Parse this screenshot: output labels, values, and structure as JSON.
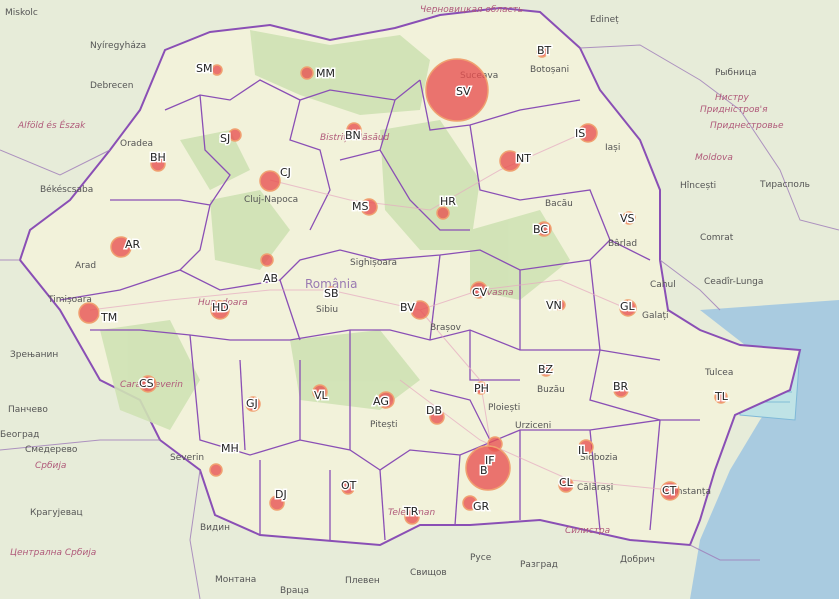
{
  "map": {
    "colors": {
      "bubble": "#e8504f",
      "bubble_stroke": "#f0a070",
      "border": "#8a4fb5",
      "land": "#e4ead3",
      "romania": "#f2f1d8",
      "forest": "#cfe2b4",
      "water": "#a9cbe0"
    },
    "country_label": "România",
    "counties": [
      {
        "code": "SM",
        "size": 5
      },
      {
        "code": "MM",
        "size": 6
      },
      {
        "code": "BT",
        "size": 5
      },
      {
        "code": "SV",
        "size": 31
      },
      {
        "code": "SJ",
        "size": 6
      },
      {
        "code": "BN",
        "size": 7
      },
      {
        "code": "IS",
        "size": 9
      },
      {
        "code": "BH",
        "size": 7
      },
      {
        "code": "CJ",
        "size": 10
      },
      {
        "code": "NT",
        "size": 10
      },
      {
        "code": "MS",
        "size": 8
      },
      {
        "code": "HR",
        "size": 6
      },
      {
        "code": "BC",
        "size": 7
      },
      {
        "code": "VS",
        "size": 6
      },
      {
        "code": "AR",
        "size": 10
      },
      {
        "code": "AB",
        "size": 6
      },
      {
        "code": "SB",
        "size": 5
      },
      {
        "code": "CV",
        "size": 8
      },
      {
        "code": "TM",
        "size": 10
      },
      {
        "code": "HD",
        "size": 9
      },
      {
        "code": "BV",
        "size": 9
      },
      {
        "code": "VN",
        "size": 5
      },
      {
        "code": "GL",
        "size": 8
      },
      {
        "code": "CS",
        "size": 8
      },
      {
        "code": "BZ",
        "size": 6
      },
      {
        "code": "BR",
        "size": 7
      },
      {
        "code": "PH",
        "size": 6
      },
      {
        "code": "GJ",
        "size": 7
      },
      {
        "code": "VL",
        "size": 7
      },
      {
        "code": "AG",
        "size": 8
      },
      {
        "code": "DB",
        "size": 7
      },
      {
        "code": "TL",
        "size": 6
      },
      {
        "code": "MH",
        "size": 6
      },
      {
        "code": "IL",
        "size": 7
      },
      {
        "code": "IF",
        "size": 7
      },
      {
        "code": "B",
        "size": 22
      },
      {
        "code": "CL",
        "size": 7
      },
      {
        "code": "DJ",
        "size": 7
      },
      {
        "code": "OT",
        "size": 6
      },
      {
        "code": "TR",
        "size": 7
      },
      {
        "code": "GR",
        "size": 7
      },
      {
        "code": "CT",
        "size": 9
      }
    ],
    "places": [
      {
        "name": "Miskolc"
      },
      {
        "name": "Nyíregyháza"
      },
      {
        "name": "Debrecen"
      },
      {
        "name": "Alföld és Észak",
        "style": "region"
      },
      {
        "name": "Oradea"
      },
      {
        "name": "Békéscsaba"
      },
      {
        "name": "Arad"
      },
      {
        "name": "Timișoara"
      },
      {
        "name": "Cluj-Napoca"
      },
      {
        "name": "Suceava"
      },
      {
        "name": "Botoșani"
      },
      {
        "name": "Iași"
      },
      {
        "name": "Bacău"
      },
      {
        "name": "Bârlad"
      },
      {
        "name": "Galați"
      },
      {
        "name": "Brașov"
      },
      {
        "name": "Sibiu"
      },
      {
        "name": "Sighișoara"
      },
      {
        "name": "Ploiești"
      },
      {
        "name": "Buzău"
      },
      {
        "name": "Pitești"
      },
      {
        "name": "Moldova",
        "style": "region"
      },
      {
        "name": "Hîncești"
      },
      {
        "name": "Comrat"
      },
      {
        "name": "Cahul"
      },
      {
        "name": "Ceadîr-Lunga"
      },
      {
        "name": "Тирасполь"
      },
      {
        "name": "Рыбница"
      },
      {
        "name": "Edineț"
      },
      {
        "name": "Черновицкая область",
        "style": "region"
      },
      {
        "name": "Придністров'я",
        "style": "region"
      },
      {
        "name": "Приднестровье",
        "style": "region"
      },
      {
        "name": "Нистру",
        "style": "region"
      },
      {
        "name": "Србија",
        "style": "region"
      },
      {
        "name": "Панчево"
      },
      {
        "name": "Београд"
      },
      {
        "name": "Смедерево"
      },
      {
        "name": "Зрењанин"
      },
      {
        "name": "Крагујевац"
      },
      {
        "name": "Централна Србија",
        "style": "region"
      },
      {
        "name": "Видин"
      },
      {
        "name": "Монтана"
      },
      {
        "name": "Враца"
      },
      {
        "name": "Плевен"
      },
      {
        "name": "Свищов"
      },
      {
        "name": "Русе"
      },
      {
        "name": "Разград"
      },
      {
        "name": "Силистра",
        "style": "region"
      },
      {
        "name": "Добрич"
      },
      {
        "name": "Tulcea"
      },
      {
        "name": "Constanța"
      },
      {
        "name": "Călărași"
      },
      {
        "name": "Slobozia"
      },
      {
        "name": "Urziceni"
      },
      {
        "name": "Severin"
      },
      {
        "name": "Caraș-Severin",
        "style": "region"
      },
      {
        "name": "Hunedoara",
        "style": "region"
      },
      {
        "name": "Covasna",
        "style": "region"
      },
      {
        "name": "Bistrița-Năsăud",
        "style": "region"
      },
      {
        "name": "Teleorman",
        "style": "region"
      }
    ]
  }
}
